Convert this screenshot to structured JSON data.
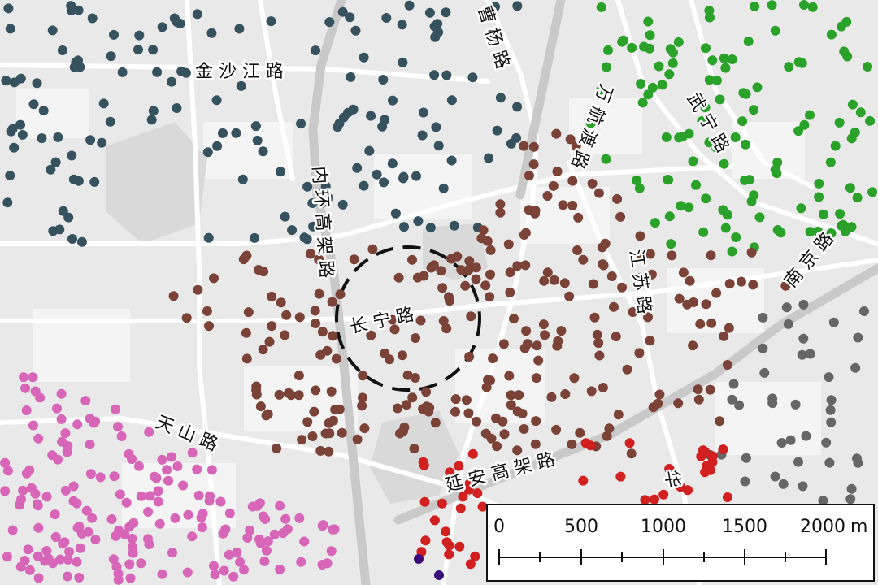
{
  "map": {
    "road_labels": [
      {
        "id": "jinshajiang-rd",
        "text": "金 沙 江 路"
      },
      {
        "id": "caoyang-rd",
        "text": "曹 杨 路"
      },
      {
        "id": "wanhangdu-rd",
        "text": "万 航 渡 路"
      },
      {
        "id": "wuning-rd",
        "text": "武 宁 路"
      },
      {
        "id": "inner-ring",
        "text": "内 环 高 架 路"
      },
      {
        "id": "changning-rd",
        "text": "长 宁 路"
      },
      {
        "id": "jiangsu-rd",
        "text": "江 苏 路"
      },
      {
        "id": "nanjing-rd",
        "text": "南 京 路"
      },
      {
        "id": "tianshan-rd",
        "text": "天 山 路"
      },
      {
        "id": "yanan-elevated",
        "text": "延 安 高 架 路"
      },
      {
        "id": "hua-partial",
        "text": "华"
      }
    ],
    "cluster_colors": {
      "slate": "#37525f",
      "green": "#2aa22a",
      "brown": "#7b4338",
      "pink": "#d765b8",
      "gray": "#666666",
      "red": "#d21f1f",
      "purple": "#3b0b7a"
    },
    "focus_circle": {
      "style": "dashed",
      "color": "#111111"
    }
  },
  "scalebar": {
    "ticks": [
      "0",
      "500",
      "1000",
      "1500",
      "2000"
    ],
    "unit": "m"
  }
}
